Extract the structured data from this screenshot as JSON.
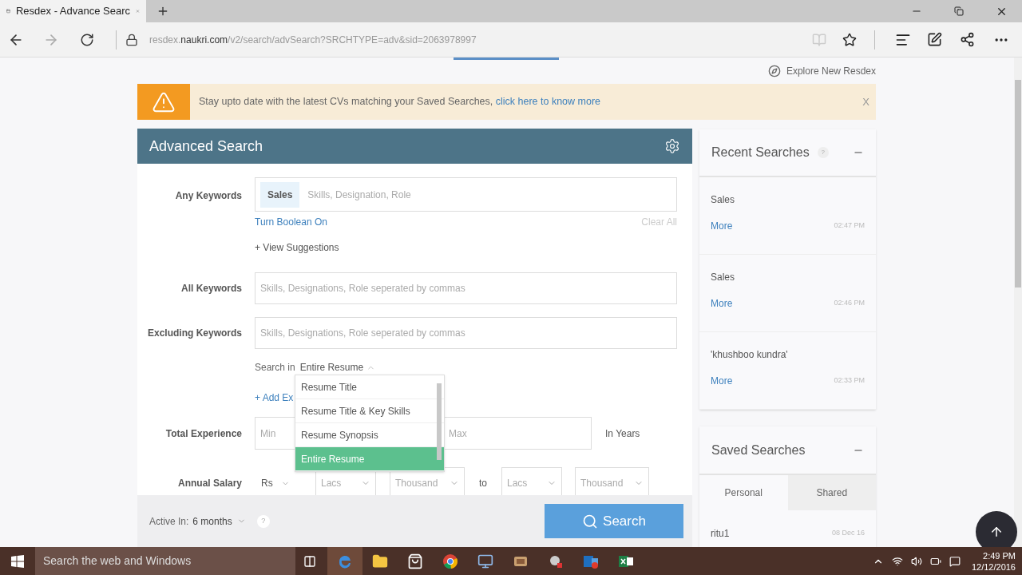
{
  "browser": {
    "tab_title": "Resdex - Advance Searc",
    "url_prefix": "resdex.",
    "url_domain": "naukri.com",
    "url_path": "/v2/search/advSearch?SRCHTYPE=adv&sid=2063978997"
  },
  "explore_link": "Explore New Resdex",
  "alert": {
    "text": "Stay upto date with the latest CVs matching your Saved Searches, ",
    "link": "click here to know more",
    "close": "X"
  },
  "form": {
    "title": "Advanced Search",
    "any_keywords": {
      "label": "Any Keywords",
      "tag": "Sales",
      "placeholder": "Skills, Designation, Role",
      "boolean_link": "Turn Boolean On",
      "clear_all": "Clear All",
      "suggestions": "+ View Suggestions"
    },
    "all_keywords": {
      "label": "All Keywords",
      "placeholder": "Skills, Designations, Role seperated by commas"
    },
    "excluding_keywords": {
      "label": "Excluding Keywords",
      "placeholder": "Skills, Designations, Role seperated by commas"
    },
    "search_in": {
      "label": "Search in",
      "value": "Entire Resume",
      "expanded": true,
      "options": [
        {
          "label": "Resume Title",
          "selected": false
        },
        {
          "label": "Resume Title & Key Skills",
          "selected": false
        },
        {
          "label": "Resume Synopsis",
          "selected": false
        },
        {
          "label": "Entire Resume",
          "selected": true
        }
      ]
    },
    "add_link": "+ Add Ex",
    "total_experience": {
      "label": "Total Experience",
      "min_placeholder": "Min",
      "max_placeholder": "Max",
      "unit": "In Years"
    },
    "annual_salary": {
      "label": "Annual Salary",
      "currency": "Rs",
      "from": [
        "Lacs",
        "Thousand"
      ],
      "to_label": "to",
      "to": [
        "Lacs",
        "Thousand"
      ]
    },
    "footer": {
      "active_label": "Active In:",
      "active_value": "6 months",
      "help": "?",
      "search_button": "Search"
    }
  },
  "recent": {
    "title": "Recent Searches",
    "help": "?",
    "items": [
      {
        "query": "Sales",
        "more": "More",
        "time": "02:47 PM"
      },
      {
        "query": "Sales",
        "more": "More",
        "time": "02:46 PM"
      },
      {
        "query": "'khushboo kundra'",
        "more": "More",
        "time": "02:33 PM"
      }
    ]
  },
  "saved": {
    "title": "Saved Searches",
    "tabs": [
      {
        "label": "Personal",
        "selected": true
      },
      {
        "label": "Shared",
        "selected": false
      }
    ],
    "items": [
      {
        "name": "ritu1",
        "date": "08 Dec 16"
      }
    ]
  },
  "taskbar": {
    "search_placeholder": "Search the web and Windows",
    "time": "2:49 PM",
    "date": "12/12/2016"
  }
}
